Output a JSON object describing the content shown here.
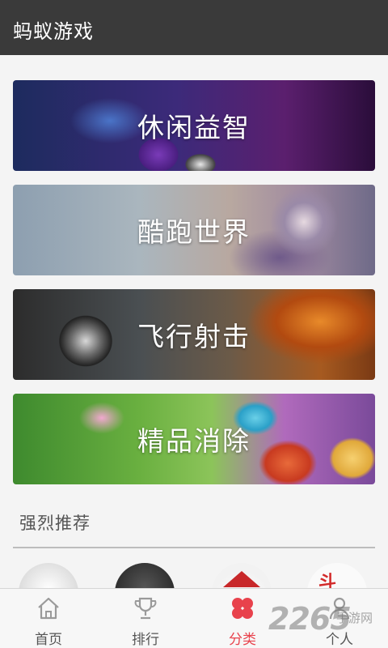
{
  "header": {
    "title": "蚂蚁游戏"
  },
  "categories": [
    {
      "label": "休闲益智"
    },
    {
      "label": "酷跑世界"
    },
    {
      "label": "飞行射击"
    },
    {
      "label": "精品消除"
    }
  ],
  "recommend": {
    "title": "强烈推荐"
  },
  "tabs": [
    {
      "label": "首页",
      "icon": "home-icon"
    },
    {
      "label": "排行",
      "icon": "trophy-icon"
    },
    {
      "label": "分类",
      "icon": "clover-icon",
      "active": true
    },
    {
      "label": "个人",
      "icon": "person-icon"
    }
  ],
  "watermark": {
    "number": "2265",
    "text": "手游网"
  },
  "colors": {
    "header_bg": "#3a3a3a",
    "active_tab": "#e8424c",
    "background": "#f4f4f4"
  }
}
